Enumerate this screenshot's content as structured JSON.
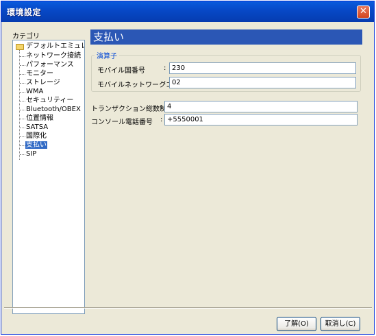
{
  "window": {
    "title": "環境設定",
    "close_glyph": "✕"
  },
  "sidebar": {
    "caption": "カテゴリ",
    "root": "デフォルトエミュレータ",
    "items": [
      "ネットワーク接続",
      "パフォーマンス",
      "モニター",
      "ストレージ",
      "WMA",
      "セキュリティー",
      "Bluetooth/OBEX",
      "位置情報",
      "SATSA",
      "国際化",
      "支払い",
      "SIP"
    ],
    "selected_index": 10
  },
  "panel": {
    "title": "支払い",
    "group_title": "演算子",
    "fields": {
      "mcc_label": "モバイル国番号",
      "mcc_value": "230",
      "mnc_label": "モバイルネットワークコード",
      "mnc_value": "02",
      "tx_label": "トランザクション総数制限",
      "tx_value": "4",
      "phone_label": "コンソール電話番号",
      "phone_value": "+5550001"
    }
  },
  "buttons": {
    "ok": "了解(O)",
    "cancel": "取消し(C)"
  },
  "colors": {
    "titlebar": "#0748c6",
    "panel_header": "#2b57b5",
    "selection": "#316ac5"
  }
}
